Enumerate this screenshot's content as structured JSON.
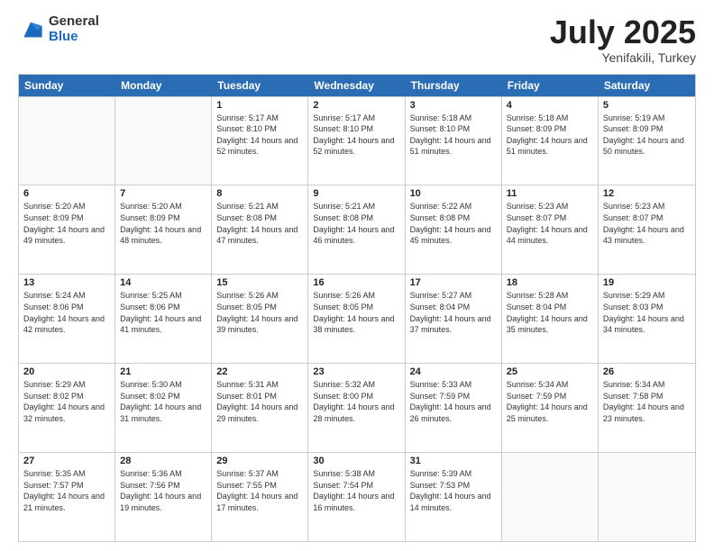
{
  "logo": {
    "general": "General",
    "blue": "Blue"
  },
  "title": "July 2025",
  "subtitle": "Yenifakili, Turkey",
  "headers": [
    "Sunday",
    "Monday",
    "Tuesday",
    "Wednesday",
    "Thursday",
    "Friday",
    "Saturday"
  ],
  "rows": [
    [
      {
        "day": "",
        "sunrise": "",
        "sunset": "",
        "daylight": "",
        "empty": true
      },
      {
        "day": "",
        "sunrise": "",
        "sunset": "",
        "daylight": "",
        "empty": true
      },
      {
        "day": "1",
        "sunrise": "Sunrise: 5:17 AM",
        "sunset": "Sunset: 8:10 PM",
        "daylight": "Daylight: 14 hours and 52 minutes."
      },
      {
        "day": "2",
        "sunrise": "Sunrise: 5:17 AM",
        "sunset": "Sunset: 8:10 PM",
        "daylight": "Daylight: 14 hours and 52 minutes."
      },
      {
        "day": "3",
        "sunrise": "Sunrise: 5:18 AM",
        "sunset": "Sunset: 8:10 PM",
        "daylight": "Daylight: 14 hours and 51 minutes."
      },
      {
        "day": "4",
        "sunrise": "Sunrise: 5:18 AM",
        "sunset": "Sunset: 8:09 PM",
        "daylight": "Daylight: 14 hours and 51 minutes."
      },
      {
        "day": "5",
        "sunrise": "Sunrise: 5:19 AM",
        "sunset": "Sunset: 8:09 PM",
        "daylight": "Daylight: 14 hours and 50 minutes."
      }
    ],
    [
      {
        "day": "6",
        "sunrise": "Sunrise: 5:20 AM",
        "sunset": "Sunset: 8:09 PM",
        "daylight": "Daylight: 14 hours and 49 minutes."
      },
      {
        "day": "7",
        "sunrise": "Sunrise: 5:20 AM",
        "sunset": "Sunset: 8:09 PM",
        "daylight": "Daylight: 14 hours and 48 minutes."
      },
      {
        "day": "8",
        "sunrise": "Sunrise: 5:21 AM",
        "sunset": "Sunset: 8:08 PM",
        "daylight": "Daylight: 14 hours and 47 minutes."
      },
      {
        "day": "9",
        "sunrise": "Sunrise: 5:21 AM",
        "sunset": "Sunset: 8:08 PM",
        "daylight": "Daylight: 14 hours and 46 minutes."
      },
      {
        "day": "10",
        "sunrise": "Sunrise: 5:22 AM",
        "sunset": "Sunset: 8:08 PM",
        "daylight": "Daylight: 14 hours and 45 minutes."
      },
      {
        "day": "11",
        "sunrise": "Sunrise: 5:23 AM",
        "sunset": "Sunset: 8:07 PM",
        "daylight": "Daylight: 14 hours and 44 minutes."
      },
      {
        "day": "12",
        "sunrise": "Sunrise: 5:23 AM",
        "sunset": "Sunset: 8:07 PM",
        "daylight": "Daylight: 14 hours and 43 minutes."
      }
    ],
    [
      {
        "day": "13",
        "sunrise": "Sunrise: 5:24 AM",
        "sunset": "Sunset: 8:06 PM",
        "daylight": "Daylight: 14 hours and 42 minutes."
      },
      {
        "day": "14",
        "sunrise": "Sunrise: 5:25 AM",
        "sunset": "Sunset: 8:06 PM",
        "daylight": "Daylight: 14 hours and 41 minutes."
      },
      {
        "day": "15",
        "sunrise": "Sunrise: 5:26 AM",
        "sunset": "Sunset: 8:05 PM",
        "daylight": "Daylight: 14 hours and 39 minutes."
      },
      {
        "day": "16",
        "sunrise": "Sunrise: 5:26 AM",
        "sunset": "Sunset: 8:05 PM",
        "daylight": "Daylight: 14 hours and 38 minutes."
      },
      {
        "day": "17",
        "sunrise": "Sunrise: 5:27 AM",
        "sunset": "Sunset: 8:04 PM",
        "daylight": "Daylight: 14 hours and 37 minutes."
      },
      {
        "day": "18",
        "sunrise": "Sunrise: 5:28 AM",
        "sunset": "Sunset: 8:04 PM",
        "daylight": "Daylight: 14 hours and 35 minutes."
      },
      {
        "day": "19",
        "sunrise": "Sunrise: 5:29 AM",
        "sunset": "Sunset: 8:03 PM",
        "daylight": "Daylight: 14 hours and 34 minutes."
      }
    ],
    [
      {
        "day": "20",
        "sunrise": "Sunrise: 5:29 AM",
        "sunset": "Sunset: 8:02 PM",
        "daylight": "Daylight: 14 hours and 32 minutes."
      },
      {
        "day": "21",
        "sunrise": "Sunrise: 5:30 AM",
        "sunset": "Sunset: 8:02 PM",
        "daylight": "Daylight: 14 hours and 31 minutes."
      },
      {
        "day": "22",
        "sunrise": "Sunrise: 5:31 AM",
        "sunset": "Sunset: 8:01 PM",
        "daylight": "Daylight: 14 hours and 29 minutes."
      },
      {
        "day": "23",
        "sunrise": "Sunrise: 5:32 AM",
        "sunset": "Sunset: 8:00 PM",
        "daylight": "Daylight: 14 hours and 28 minutes."
      },
      {
        "day": "24",
        "sunrise": "Sunrise: 5:33 AM",
        "sunset": "Sunset: 7:59 PM",
        "daylight": "Daylight: 14 hours and 26 minutes."
      },
      {
        "day": "25",
        "sunrise": "Sunrise: 5:34 AM",
        "sunset": "Sunset: 7:59 PM",
        "daylight": "Daylight: 14 hours and 25 minutes."
      },
      {
        "day": "26",
        "sunrise": "Sunrise: 5:34 AM",
        "sunset": "Sunset: 7:58 PM",
        "daylight": "Daylight: 14 hours and 23 minutes."
      }
    ],
    [
      {
        "day": "27",
        "sunrise": "Sunrise: 5:35 AM",
        "sunset": "Sunset: 7:57 PM",
        "daylight": "Daylight: 14 hours and 21 minutes."
      },
      {
        "day": "28",
        "sunrise": "Sunrise: 5:36 AM",
        "sunset": "Sunset: 7:56 PM",
        "daylight": "Daylight: 14 hours and 19 minutes."
      },
      {
        "day": "29",
        "sunrise": "Sunrise: 5:37 AM",
        "sunset": "Sunset: 7:55 PM",
        "daylight": "Daylight: 14 hours and 17 minutes."
      },
      {
        "day": "30",
        "sunrise": "Sunrise: 5:38 AM",
        "sunset": "Sunset: 7:54 PM",
        "daylight": "Daylight: 14 hours and 16 minutes."
      },
      {
        "day": "31",
        "sunrise": "Sunrise: 5:39 AM",
        "sunset": "Sunset: 7:53 PM",
        "daylight": "Daylight: 14 hours and 14 minutes."
      },
      {
        "day": "",
        "sunrise": "",
        "sunset": "",
        "daylight": "",
        "empty": true
      },
      {
        "day": "",
        "sunrise": "",
        "sunset": "",
        "daylight": "",
        "empty": true
      }
    ]
  ]
}
